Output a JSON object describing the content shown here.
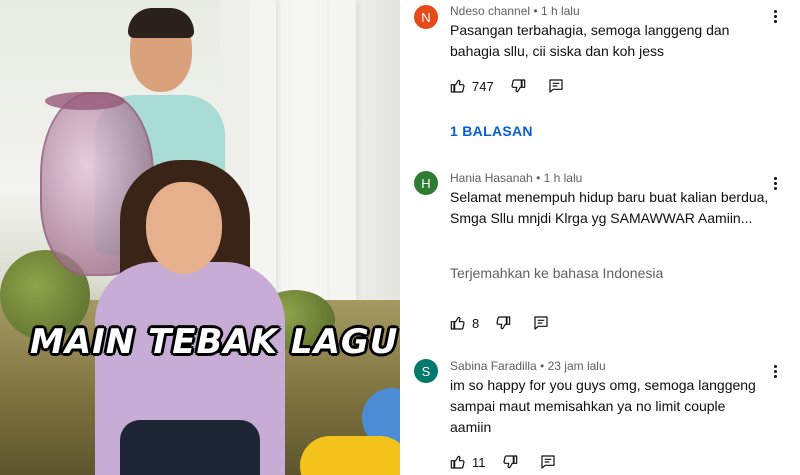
{
  "video": {
    "overlay_title": "MAIN TEBAK LAGU"
  },
  "comments": [
    {
      "avatar_letter": "N",
      "avatar_color": "#e64a19",
      "author": "Ndeso channel",
      "time": "1 h lalu",
      "text": "Pasangan terbahagia, semoga langgeng dan bahagia sllu, cii siska dan koh jess",
      "likes": "747",
      "replies_label": "1 BALASAN"
    },
    {
      "avatar_letter": "H",
      "avatar_color": "#2e7d32",
      "author": "Hania Hasanah",
      "time": "1 h lalu",
      "text": "Selamat menempuh hidup baru buat kalian berdua, Smga Sllu mnjdi Klrga yg SAMAWWAR Aamiin...",
      "translate_label": "Terjemahkan ke bahasa Indonesia",
      "likes": "8"
    },
    {
      "avatar_letter": "S",
      "avatar_color": "#00796b",
      "author": "Sabina Faradilla",
      "time": "23 jam lalu",
      "text": "im so happy for you guys omg, semoga langgeng sampai maut memisahkan ya no limit couple aamiin",
      "likes": "11"
    }
  ],
  "icons": {
    "like": "thumbs-up-icon",
    "dislike": "thumbs-down-icon",
    "reply": "comment-reply-icon",
    "menu": "more-vertical-icon"
  }
}
